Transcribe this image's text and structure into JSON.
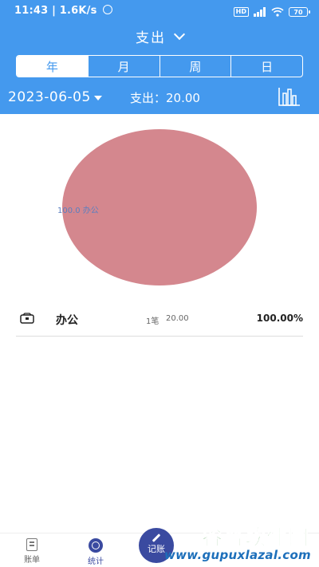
{
  "status_bar": {
    "time_speed": "11:43 | 1.6K/s",
    "network_tag": "HD",
    "battery_level": "70"
  },
  "header": {
    "title": "支出",
    "tabs": [
      {
        "label": "年",
        "active": true
      },
      {
        "label": "月",
        "active": false
      },
      {
        "label": "周",
        "active": false
      },
      {
        "label": "日",
        "active": false
      }
    ],
    "date": "2023-06-05",
    "summary": "支出：20.00"
  },
  "pie": {
    "label": "100.0   办公"
  },
  "chart_data": {
    "type": "pie",
    "slices": [
      {
        "label": "办公",
        "value": 100.0,
        "color": "#d4878e"
      }
    ]
  },
  "list": [
    {
      "icon": "wallet-icon",
      "name": "办公",
      "count": "1笔",
      "amount": "20.00",
      "percent": "100.00%"
    }
  ],
  "bottom_nav": {
    "bills": "账单",
    "stats": "统计",
    "record": "记账"
  },
  "watermark": {
    "title": "谷普软件园",
    "url": "www.gupuxlazal.com"
  },
  "colors": {
    "header": "#4499ee",
    "pie": "#d4878e",
    "nav_active": "#3a4aa0"
  }
}
